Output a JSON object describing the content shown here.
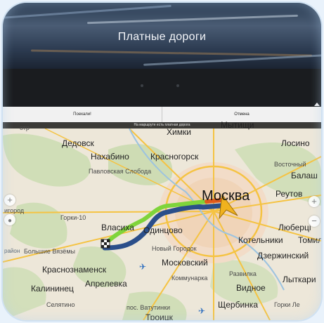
{
  "banner": {
    "title": "Платные дороги"
  },
  "actions": {
    "go_label": "Поехали!",
    "cancel_label": "Отмена"
  },
  "notice": {
    "text": "На маршруте есть платная дорога"
  },
  "map_labels": {
    "mytishchi": "Мытищи",
    "khimki": "Химки",
    "dedovsk": "Дедовск",
    "losino": "Лосино",
    "nakhabino": "Нахабино",
    "krasnogorsk": "Красногорск",
    "vostochny": "Восточный",
    "pavlovskaya": "Павловская Слобода",
    "balash": "Балаш",
    "moskva": "Москва",
    "reutov": "Реутов",
    "zvenigorod": "игород",
    "gorki": "Горки-10",
    "lyuberts": "Люберці",
    "vlasikha": "Власиха",
    "odintsovo": "Одинцово",
    "kotelniki": "Котельники",
    "tomil": "Томил",
    "rayon": "район",
    "bolshie": "Большие Вязёмы",
    "novy": "Новый Городок",
    "dzerzh": "Дзержинский",
    "krasnozn": "Краснознаменск",
    "moskovsky": "Московский",
    "razvilka": "Развилка",
    "lytkarino": "Лыткари",
    "kommunarka": "Коммунарка",
    "kalininets": "Калининец",
    "aprelevka": "Апрелевка",
    "vidnoe": "Видное",
    "selyatino": "Селятино",
    "vatutinki": "пос. Ватутинки",
    "shcherbinka": "Щербинка",
    "gorki_len": "Горки Ле",
    "troitsk": "Троицк",
    "otr": "отр"
  },
  "colors": {
    "route_main": "#7fd43a",
    "route_alt": "#2b4f8a",
    "toll_segment": "#e05a1c",
    "marker": "#f0b21e"
  },
  "icons": {
    "zoom_in": "plus-icon",
    "zoom_out": "minus-icon",
    "mic": "mic-icon",
    "finish": "finish-flag-icon",
    "position": "position-arrow-icon",
    "airport": "airport-icon"
  }
}
